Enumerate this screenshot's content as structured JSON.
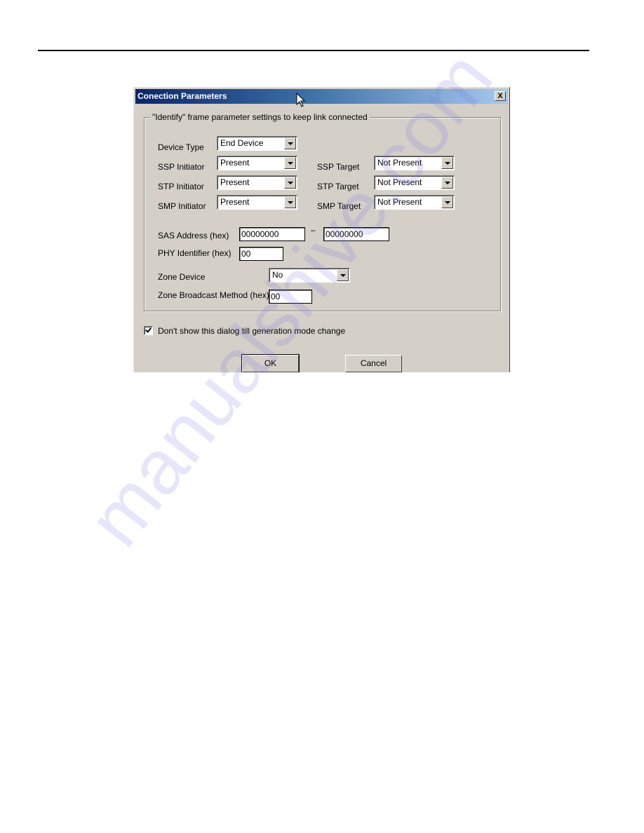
{
  "page": {
    "watermark": "manualshive.com"
  },
  "dialog": {
    "title": "Conection Parameters",
    "close_label": "X",
    "group_label": "\"Identify\" frame parameter settings to keep link connected",
    "fields": {
      "device_type": {
        "label": "Device Type",
        "value": "End Device"
      },
      "ssp_initiator": {
        "label": "SSP Initiator",
        "value": "Present"
      },
      "stp_initiator": {
        "label": "STP Initiator",
        "value": "Present"
      },
      "smp_initiator": {
        "label": "SMP Initiator",
        "value": "Present"
      },
      "ssp_target": {
        "label": "SSP Target",
        "value": "Not Present"
      },
      "stp_target": {
        "label": "STP Target",
        "value": "Not Present"
      },
      "smp_target": {
        "label": "SMP Target",
        "value": "Not Present"
      },
      "sas_address": {
        "label": "SAS Address (hex)",
        "value_high": "00000000",
        "separator": "–",
        "value_low": "00000000"
      },
      "phy_identifier": {
        "label": "PHY Identifier (hex)",
        "value": "00"
      },
      "zone_device": {
        "label": "Zone Device",
        "value": "No"
      },
      "zone_broadcast": {
        "label": "Zone Broadcast Method (hex)",
        "value": "00"
      }
    },
    "checkbox": {
      "label": "Don't show this dialog till generation mode change",
      "checked": true
    },
    "buttons": {
      "ok": "OK",
      "cancel": "Cancel"
    }
  }
}
